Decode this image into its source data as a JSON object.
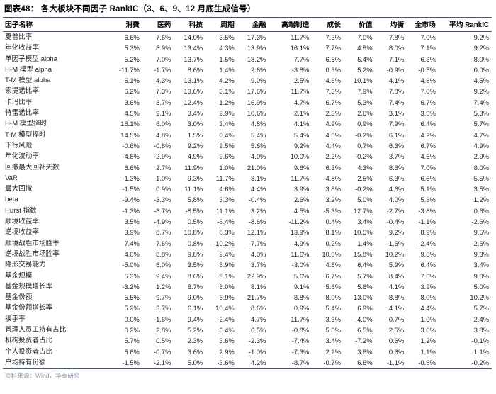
{
  "figure": {
    "title": "图表48： 各大板块不同因子 RankIC（3、6、9、12 月底生成信号）",
    "source": "资料来源：Wind，华泰研究"
  },
  "table": {
    "columns": [
      {
        "key": "name",
        "label": "因子名称",
        "align": "left"
      },
      {
        "key": "consumer",
        "label": "消费",
        "align": "right"
      },
      {
        "key": "pharma",
        "label": "医药",
        "align": "right"
      },
      {
        "key": "tech",
        "label": "科技",
        "align": "right"
      },
      {
        "key": "cyclical",
        "label": "周期",
        "align": "right"
      },
      {
        "key": "finance",
        "label": "金融",
        "align": "right"
      },
      {
        "key": "advanced_manufacturing",
        "label": "高端制造",
        "align": "right"
      },
      {
        "key": "growth",
        "label": "成长",
        "align": "right"
      },
      {
        "key": "value",
        "label": "价值",
        "align": "right"
      },
      {
        "key": "balanced",
        "label": "均衡",
        "align": "right"
      },
      {
        "key": "whole_market",
        "label": "全市场",
        "align": "right"
      },
      {
        "key": "avg_rankic",
        "label": "平均 RankIC",
        "align": "right"
      }
    ],
    "rows": [
      {
        "name": "夏普比率",
        "values": [
          "6.6%",
          "7.6%",
          "14.0%",
          "3.5%",
          "17.3%",
          "11.7%",
          "7.3%",
          "7.0%",
          "7.8%",
          "7.0%",
          "9.2%"
        ]
      },
      {
        "name": "年化收益率",
        "values": [
          "5.3%",
          "8.9%",
          "13.4%",
          "4.3%",
          "13.9%",
          "16.1%",
          "7.7%",
          "4.8%",
          "8.0%",
          "7.1%",
          "9.2%"
        ]
      },
      {
        "name": "单因子模型 alpha",
        "values": [
          "5.2%",
          "7.0%",
          "13.7%",
          "1.5%",
          "18.2%",
          "7.7%",
          "6.6%",
          "5.4%",
          "7.1%",
          "6.3%",
          "8.0%"
        ]
      },
      {
        "name": "H-M 模型 alpha",
        "values": [
          "-11.7%",
          "-1.7%",
          "8.6%",
          "1.4%",
          "2.6%",
          "-3.8%",
          "0.3%",
          "5.2%",
          "-0.9%",
          "-0.5%",
          "0.0%"
        ]
      },
      {
        "name": "T-M 模型 alpha",
        "values": [
          "-6.1%",
          "4.3%",
          "13.1%",
          "4.2%",
          "9.0%",
          "-2.5%",
          "4.6%",
          "10.1%",
          "4.1%",
          "4.6%",
          "4.5%"
        ]
      },
      {
        "name": "索提诺比率",
        "values": [
          "6.2%",
          "7.3%",
          "13.6%",
          "3.1%",
          "17.6%",
          "11.7%",
          "7.3%",
          "7.9%",
          "7.8%",
          "7.0%",
          "9.2%"
        ]
      },
      {
        "name": "卡玛比率",
        "values": [
          "3.6%",
          "8.7%",
          "12.4%",
          "1.2%",
          "16.9%",
          "4.7%",
          "6.7%",
          "5.3%",
          "7.4%",
          "6.7%",
          "7.4%"
        ]
      },
      {
        "name": "特雷诺比率",
        "values": [
          "4.5%",
          "9.1%",
          "3.4%",
          "9.9%",
          "10.6%",
          "2.1%",
          "2.3%",
          "2.6%",
          "3.1%",
          "3.6%",
          "5.3%"
        ]
      },
      {
        "name": "H-M 模型择时",
        "values": [
          "16.1%",
          "6.0%",
          "3.0%",
          "3.4%",
          "4.8%",
          "4.1%",
          "4.9%",
          "0.9%",
          "7.9%",
          "6.4%",
          "5.7%"
        ]
      },
      {
        "name": "T-M 模型择时",
        "values": [
          "14.5%",
          "4.8%",
          "1.5%",
          "0.4%",
          "5.4%",
          "5.4%",
          "4.0%",
          "-0.2%",
          "6.1%",
          "4.2%",
          "4.7%"
        ]
      },
      {
        "name": "下行风险",
        "values": [
          "-0.6%",
          "-0.6%",
          "9.2%",
          "9.5%",
          "5.6%",
          "9.2%",
          "4.4%",
          "0.7%",
          "6.3%",
          "6.7%",
          "4.9%"
        ]
      },
      {
        "name": "年化波动率",
        "values": [
          "-4.8%",
          "-2.9%",
          "4.9%",
          "9.6%",
          "4.0%",
          "10.0%",
          "2.2%",
          "-0.2%",
          "3.7%",
          "4.6%",
          "2.9%"
        ]
      },
      {
        "name": "回撤最大回补天数",
        "values": [
          "6.6%",
          "2.7%",
          "11.9%",
          "1.0%",
          "21.0%",
          "9.6%",
          "6.3%",
          "4.3%",
          "8.6%",
          "7.0%",
          "8.0%"
        ]
      },
      {
        "name": "VaR",
        "values": [
          "-1.3%",
          "1.0%",
          "9.3%",
          "11.7%",
          "3.1%",
          "11.7%",
          "4.8%",
          "2.5%",
          "6.3%",
          "6.6%",
          "5.5%"
        ]
      },
      {
        "name": "最大回撤",
        "values": [
          "-1.5%",
          "0.9%",
          "11.1%",
          "4.6%",
          "4.4%",
          "3.9%",
          "3.8%",
          "-0.2%",
          "4.6%",
          "5.1%",
          "3.5%"
        ]
      },
      {
        "name": "beta",
        "values": [
          "-9.4%",
          "-3.3%",
          "5.8%",
          "3.3%",
          "-0.4%",
          "2.6%",
          "3.2%",
          "5.0%",
          "4.0%",
          "5.3%",
          "1.2%"
        ]
      },
      {
        "name": "Hurst 指数",
        "values": [
          "-1.3%",
          "-8.7%",
          "-8.5%",
          "11.1%",
          "3.2%",
          "4.5%",
          "-5.3%",
          "12.7%",
          "-2.7%",
          "-3.8%",
          "0.6%"
        ]
      },
      {
        "name": "顺境收益率",
        "values": [
          "3.5%",
          "-4.9%",
          "0.5%",
          "-6.4%",
          "-8.6%",
          "-11.2%",
          "0.4%",
          "3.4%",
          "-0.4%",
          "-1.1%",
          "-2.6%"
        ]
      },
      {
        "name": "逆境收益率",
        "values": [
          "3.9%",
          "8.7%",
          "10.8%",
          "8.3%",
          "12.1%",
          "13.9%",
          "8.1%",
          "10.5%",
          "9.2%",
          "8.9%",
          "9.5%"
        ]
      },
      {
        "name": "顺境战胜市场胜率",
        "values": [
          "7.4%",
          "-7.6%",
          "-0.8%",
          "-10.2%",
          "-7.7%",
          "-4.9%",
          "0.2%",
          "1.4%",
          "-1.6%",
          "-2.4%",
          "-2.6%"
        ]
      },
      {
        "name": "逆境战胜市场胜率",
        "values": [
          "4.0%",
          "8.8%",
          "9.8%",
          "9.4%",
          "4.0%",
          "11.6%",
          "10.0%",
          "15.8%",
          "10.2%",
          "9.8%",
          "9.3%"
        ]
      },
      {
        "name": "隐形交易能力",
        "values": [
          "-5.0%",
          "6.0%",
          "3.5%",
          "8.9%",
          "3.7%",
          "-3.0%",
          "4.6%",
          "6.4%",
          "5.9%",
          "6.4%",
          "3.4%"
        ]
      },
      {
        "name": "基金规模",
        "values": [
          "5.3%",
          "9.4%",
          "8.6%",
          "8.1%",
          "22.9%",
          "5.6%",
          "6.7%",
          "5.7%",
          "8.4%",
          "7.6%",
          "9.0%"
        ]
      },
      {
        "name": "基金规模增长率",
        "values": [
          "-3.2%",
          "1.2%",
          "8.7%",
          "6.0%",
          "8.1%",
          "9.1%",
          "5.6%",
          "5.6%",
          "4.1%",
          "3.9%",
          "5.0%"
        ]
      },
      {
        "name": "基金份额",
        "values": [
          "5.5%",
          "9.7%",
          "9.0%",
          "6.9%",
          "21.7%",
          "8.8%",
          "8.0%",
          "13.0%",
          "8.8%",
          "8.0%",
          "10.2%"
        ]
      },
      {
        "name": "基金份额增长率",
        "values": [
          "5.2%",
          "3.7%",
          "6.1%",
          "10.4%",
          "8.6%",
          "0.9%",
          "5.4%",
          "6.9%",
          "4.1%",
          "4.4%",
          "5.7%"
        ]
      },
      {
        "name": "换手率",
        "values": [
          "0.0%",
          "-1.6%",
          "9.4%",
          "-2.4%",
          "4.7%",
          "11.7%",
          "3.3%",
          "-4.0%",
          "0.7%",
          "1.9%",
          "2.4%"
        ]
      },
      {
        "name": "管理人员工持有占比",
        "values": [
          "0.2%",
          "2.8%",
          "5.2%",
          "6.4%",
          "6.5%",
          "-0.8%",
          "5.0%",
          "6.5%",
          "2.5%",
          "3.0%",
          "3.8%"
        ]
      },
      {
        "name": "机构投资者占比",
        "values": [
          "5.7%",
          "0.5%",
          "2.3%",
          "3.6%",
          "-2.3%",
          "-7.4%",
          "3.4%",
          "-7.2%",
          "0.6%",
          "1.2%",
          "-0.1%"
        ]
      },
      {
        "name": "个人投资者占比",
        "values": [
          "5.6%",
          "-0.7%",
          "3.6%",
          "2.9%",
          "-1.0%",
          "-7.3%",
          "2.2%",
          "3.6%",
          "0.6%",
          "1.1%",
          "1.1%"
        ]
      },
      {
        "name": "户均持有份额",
        "values": [
          "-1.5%",
          "-2.1%",
          "5.0%",
          "-3.6%",
          "4.2%",
          "-8.7%",
          "-0.7%",
          "6.6%",
          "-1.1%",
          "-0.6%",
          "-0.2%"
        ]
      }
    ]
  }
}
